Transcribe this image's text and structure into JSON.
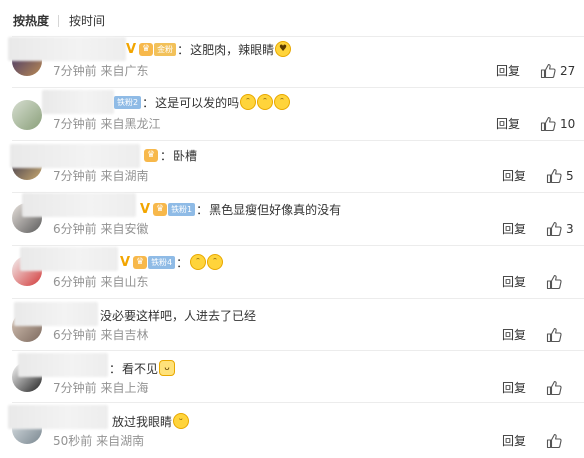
{
  "sort": {
    "hot": "按热度",
    "time": "按时间"
  },
  "labels": {
    "reply": "回复"
  },
  "comments": [
    {
      "badge": "金粉",
      "badge_level": "gold",
      "vip": "V",
      "text": "这肥肉，辣眼睛",
      "emojis": [
        "heart-eyes-emoji"
      ],
      "time": "7分钟前",
      "location": "来自广东",
      "likes": "27"
    },
    {
      "badge": "铁粉2",
      "badge_level": "blue",
      "vip": "",
      "text": "这是可以发的吗",
      "emojis": [
        "crying-laugh-emoji",
        "crying-laugh-emoji",
        "crying-laugh-emoji"
      ],
      "time": "7分钟前",
      "location": "来自黑龙江",
      "likes": "10"
    },
    {
      "badge": "",
      "badge_level": "",
      "vip": "",
      "text": "卧槽",
      "emojis": [],
      "time": "7分钟前",
      "location": "来自湖南",
      "likes": "5"
    },
    {
      "badge": "铁粉1",
      "badge_level": "blue",
      "vip": "V",
      "text": "黑色显瘦但好像真的没有",
      "emojis": [],
      "time": "6分钟前",
      "location": "来自安徽",
      "likes": "3"
    },
    {
      "badge": "铁粉4",
      "badge_level": "blue",
      "vip": "V",
      "text": "",
      "emojis": [
        "crying-laugh-emoji",
        "crying-laugh-emoji"
      ],
      "time": "6分钟前",
      "location": "来自山东",
      "likes": ""
    },
    {
      "badge": "",
      "badge_level": "",
      "vip": "",
      "text": "没必要这样吧，人进去了已经",
      "emojis": [],
      "time": "6分钟前",
      "location": "来自吉林",
      "likes": ""
    },
    {
      "badge": "",
      "badge_level": "",
      "vip": "",
      "text": "看不见",
      "emojis": [
        "doge-emoji"
      ],
      "time": "7分钟前",
      "location": "来自上海",
      "likes": ""
    },
    {
      "badge": "",
      "badge_level": "",
      "vip": "",
      "text": "放过我眼睛",
      "emojis": [
        "crying-emoji"
      ],
      "time": "50秒前",
      "location": "来自湖南",
      "likes": ""
    }
  ],
  "colors": {
    "vip": "#f2a500",
    "meta": "#939393",
    "divider": "#ececec"
  }
}
